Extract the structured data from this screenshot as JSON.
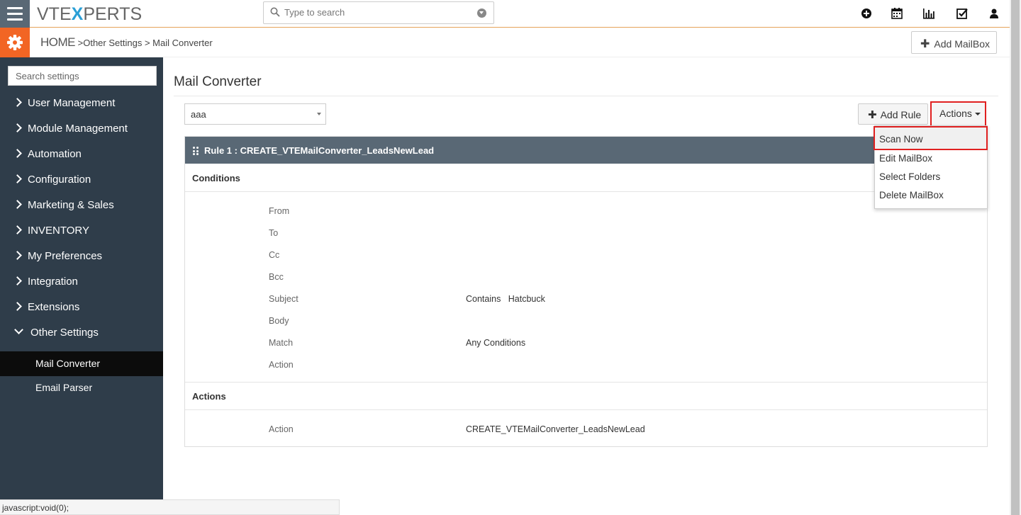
{
  "app": {
    "logo_left": "VTE",
    "logo_x": "X",
    "logo_right": "PERTS"
  },
  "search": {
    "placeholder": "Type to search"
  },
  "top_icons": [
    "plus-circle-icon",
    "calendar-icon",
    "bar-chart-icon",
    "checkbox-icon",
    "user-icon"
  ],
  "breadcrumb": {
    "home": "HOME",
    "sep1": " >",
    "level1": "Other Settings",
    "sep2": " > ",
    "level2": "Mail Converter"
  },
  "header": {
    "add_mailbox_label": "Add MailBox"
  },
  "sidebar": {
    "search_placeholder": "Search settings",
    "items": [
      {
        "label": "User Management"
      },
      {
        "label": "Module Management"
      },
      {
        "label": "Automation"
      },
      {
        "label": "Configuration"
      },
      {
        "label": "Marketing & Sales"
      },
      {
        "label": "INVENTORY"
      },
      {
        "label": "My Preferences"
      },
      {
        "label": "Integration"
      },
      {
        "label": "Extensions"
      },
      {
        "label": "Other Settings"
      }
    ],
    "subitems": [
      {
        "label": "Mail Converter",
        "active": true
      },
      {
        "label": "Email Parser",
        "active": false
      }
    ]
  },
  "main": {
    "title": "Mail Converter",
    "mailbox_select": "aaa",
    "add_rule_label": "Add Rule",
    "actions_label": "Actions",
    "rule_title": "Rule 1 : CREATE_VTEMailConverter_LeadsNewLead",
    "conditions_title": "Conditions",
    "conditions": [
      {
        "label": "From",
        "value": ""
      },
      {
        "label": "To",
        "value": ""
      },
      {
        "label": "Cc",
        "value": ""
      },
      {
        "label": "Bcc",
        "value": ""
      },
      {
        "label": "Subject",
        "value": "Contains   Hatcbuck"
      },
      {
        "label": "Body",
        "value": ""
      },
      {
        "label": "Match",
        "value": "Any Conditions"
      },
      {
        "label": "Action",
        "value": ""
      }
    ],
    "actions_title": "Actions",
    "actions": [
      {
        "label": "Action",
        "value": "CREATE_VTEMailConverter_LeadsNewLead"
      }
    ]
  },
  "actions_menu": [
    "Scan Now",
    "Edit MailBox",
    "Select Folders",
    "Delete MailBox"
  ],
  "status_bar": "javascript:void(0);",
  "colors": {
    "sidebar_bg": "#2f3d4a",
    "header_bar": "#596875",
    "accent_orange": "#f26524",
    "highlight_red": "#e02020"
  }
}
